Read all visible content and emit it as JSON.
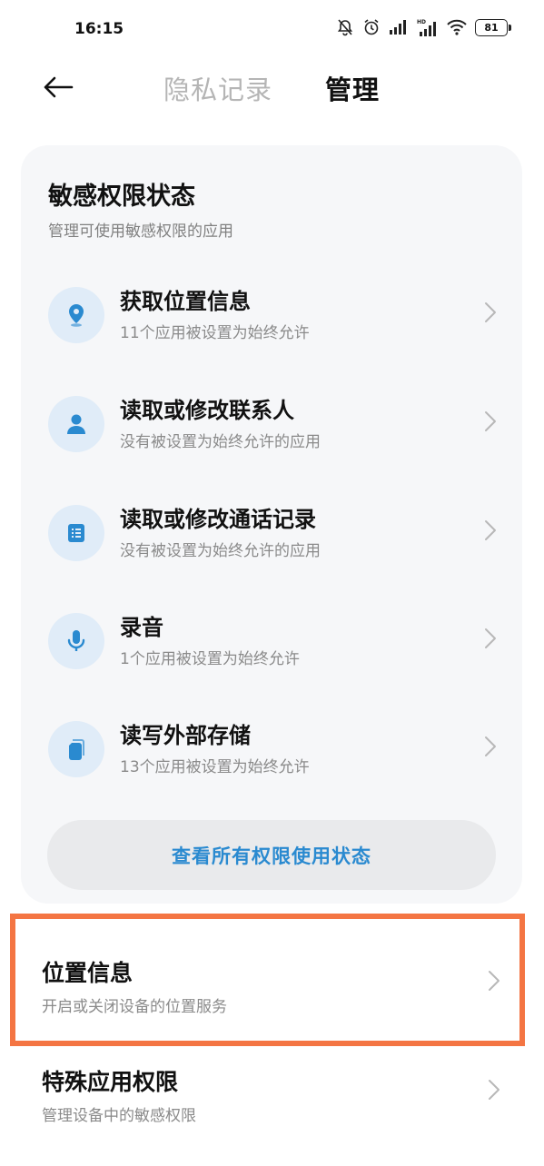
{
  "status_bar": {
    "time": "16:15",
    "battery": "81",
    "icons": [
      "mute-icon",
      "alarm-icon",
      "signal-icon",
      "hd-signal-icon",
      "wifi-icon",
      "battery-icon"
    ]
  },
  "nav": {
    "back_icon": "back-arrow-icon",
    "tabs": [
      {
        "label": "隐私记录",
        "active": false
      },
      {
        "label": "管理",
        "active": true
      }
    ]
  },
  "sensitive_card": {
    "title": "敏感权限状态",
    "subtitle": "管理可使用敏感权限的应用",
    "items": [
      {
        "icon": "location-icon",
        "title": "获取位置信息",
        "desc": "11个应用被设置为始终允许"
      },
      {
        "icon": "contact-icon",
        "title": "读取或修改联系人",
        "desc": "没有被设置为始终允许的应用"
      },
      {
        "icon": "call-log-icon",
        "title": "读取或修改通话记录",
        "desc": "没有被设置为始终允许的应用"
      },
      {
        "icon": "microphone-icon",
        "title": "录音",
        "desc": "1个应用被设置为始终允许"
      },
      {
        "icon": "storage-icon",
        "title": "读写外部存储",
        "desc": "13个应用被设置为始终允许"
      }
    ],
    "view_all_label": "查看所有权限使用状态"
  },
  "settings_rows": [
    {
      "title": "位置信息",
      "desc": "开启或关闭设备的位置服务"
    },
    {
      "title": "特殊应用权限",
      "desc": "管理设备中的敏感权限"
    }
  ],
  "colors": {
    "accent": "#2a8ad0",
    "icon_bg": "#e0ecf8",
    "highlight_border": "#f47543",
    "card_bg": "#f6f7f9"
  }
}
